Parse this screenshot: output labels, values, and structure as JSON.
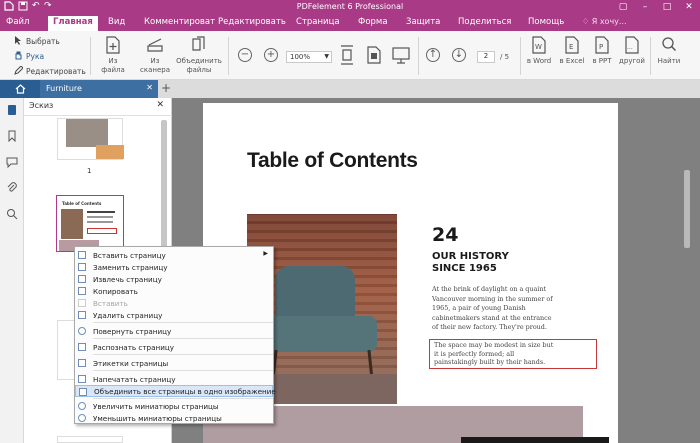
{
  "app": {
    "title": "PDFelement 6 Professional",
    "accent": "#a93a86"
  },
  "menu": {
    "items": [
      "Файл",
      "Главная",
      "Вид",
      "Комментироват",
      "Редактировать",
      "Страница",
      "Форма",
      "Защита",
      "Поделиться",
      "Помощь"
    ],
    "active": "Главная",
    "search": "Я хочу..."
  },
  "ribbon": {
    "select": "Выбрать",
    "hand": "Рука",
    "edit": "Редактировать",
    "from_file": "Из файла",
    "from_scanner": "Из сканера",
    "combine": "Объединить файлы",
    "zoom": "100%",
    "page_current": "2",
    "page_total": "/ 5",
    "to_word": "в Word",
    "to_excel": "в Excel",
    "to_ppt": "в PPT",
    "other": "другой",
    "find": "Найти"
  },
  "tabs": {
    "document": "Furniture"
  },
  "thumbnails": {
    "title": "Эскиз",
    "page1": "1",
    "mini_title": "Table of Contents"
  },
  "context_menu": [
    {
      "label": "Вставить страницу",
      "disabled": false,
      "submenu": true
    },
    {
      "label": "Заменить страницу",
      "disabled": false
    },
    {
      "label": "Извлечь страницу",
      "disabled": false
    },
    {
      "label": "Копировать",
      "disabled": false
    },
    {
      "label": "Вставить",
      "disabled": true
    },
    {
      "label": "Удалить страницу",
      "disabled": false
    },
    {
      "label": "Повернуть страницу",
      "disabled": false
    },
    {
      "label": "Распознать страницу",
      "disabled": false
    },
    {
      "label": "Этикетки страницы",
      "disabled": false
    },
    {
      "label": "Напечатать страницу",
      "disabled": false
    },
    {
      "label": "Объединить все страницы в одно изображение",
      "disabled": false,
      "highlighted": true
    },
    {
      "label": "Увеличить миниатюры страницы",
      "disabled": false
    },
    {
      "label": "Уменьшить миниатюры страницы",
      "disabled": false
    }
  ],
  "page": {
    "title": "Table of Contents",
    "number": "24",
    "heading": "OUR HISTORY\nSINCE 1965",
    "body": "At the brink of daylight on a quaint Vancouver morning in the summer of 1965, a pair of young Danish cabinetmakers stand at the entrance of their new factory. They're proud.",
    "boxed": "The space may be modest in size but it is perfectly formed; all painstakingly built by their hands."
  }
}
